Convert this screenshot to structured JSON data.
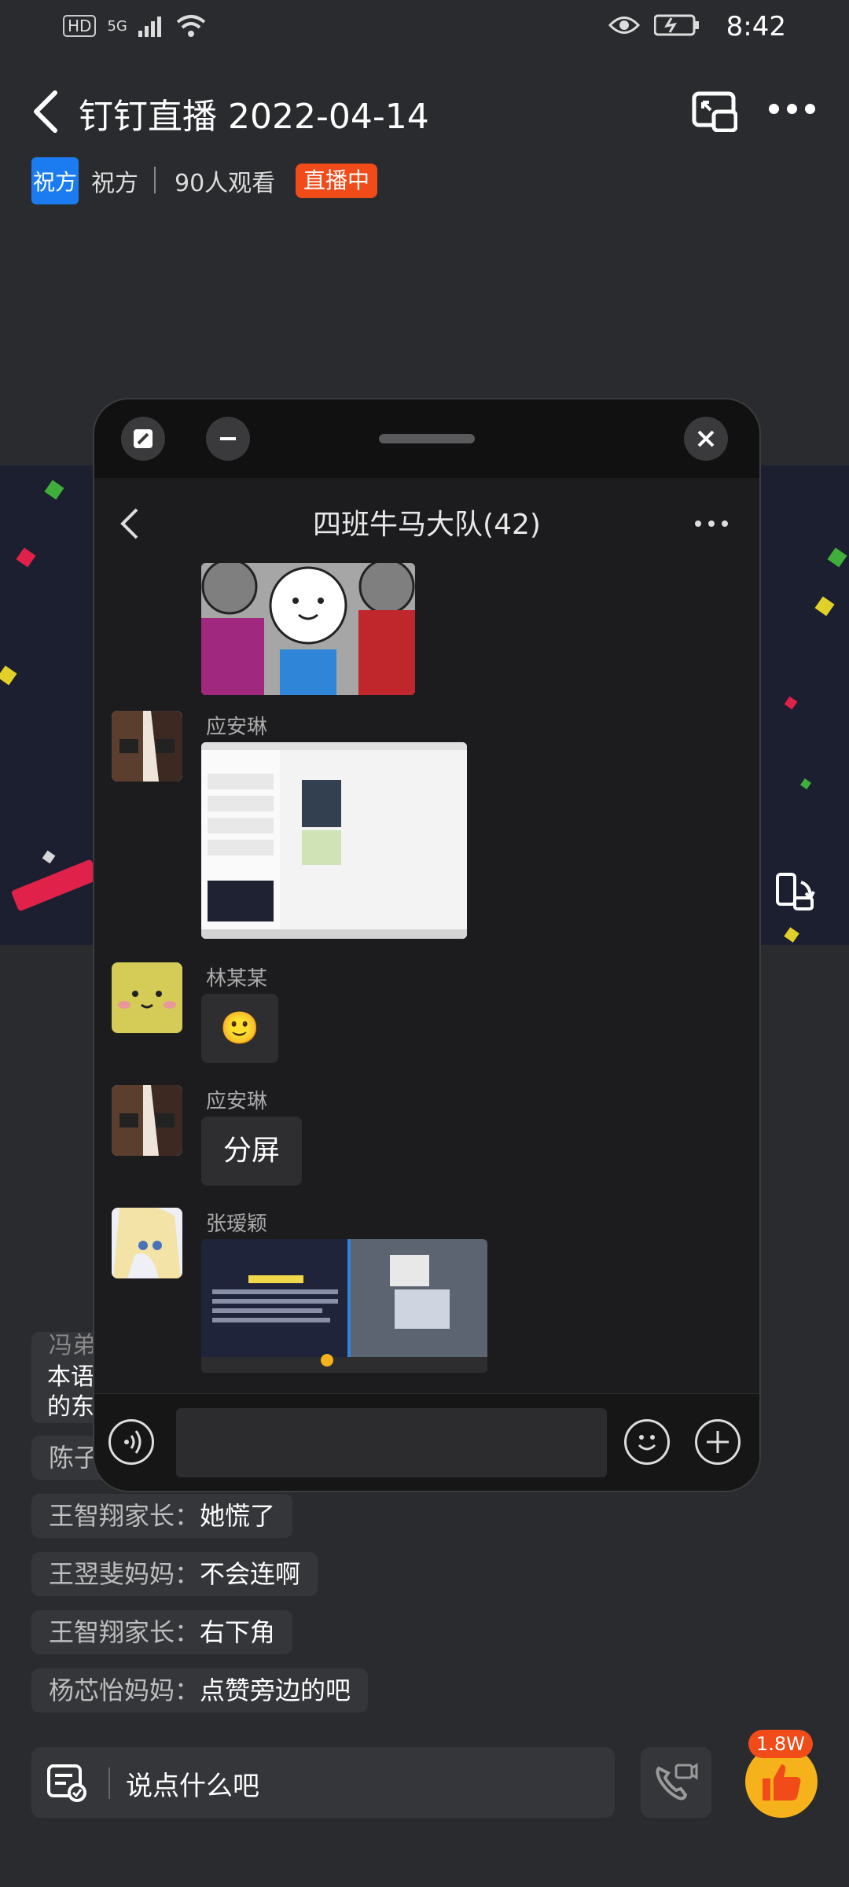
{
  "status_bar": {
    "left_labels": [
      "HD",
      "5G"
    ],
    "time": "8:42"
  },
  "header": {
    "title": "钉钉直播 2022-04-14",
    "host_avatar_text": "祝方",
    "host_name": "祝方",
    "viewers": "90人观看",
    "live_badge": "直播中"
  },
  "floating_window": {
    "title": "四班牛马大队(42)",
    "messages": [
      {
        "sender": "应安琳",
        "type": "image"
      },
      {
        "sender": "林某某",
        "type": "emoji",
        "content": "🙂"
      },
      {
        "sender": "应安琳",
        "type": "text",
        "content": "分屏"
      },
      {
        "sender": "张瑷颖",
        "type": "image"
      }
    ]
  },
  "comments": {
    "partial_1": "冯弟",
    "partial_1_line2": "本语",
    "partial_1_line3": "的东",
    "partial_2": "陈子",
    "items": [
      {
        "who": "王智翔家长：",
        "msg": "她慌了"
      },
      {
        "who": "王翌斐妈妈：",
        "msg": "不会连啊"
      },
      {
        "who": "王智翔家长：",
        "msg": "右下角"
      },
      {
        "who": "杨芯怡妈妈：",
        "msg": "点赞旁边的吧"
      }
    ]
  },
  "input_bar": {
    "placeholder": "说点什么吧"
  },
  "like": {
    "count": "1.8W"
  },
  "colors": {
    "live_badge": "#f04b19",
    "host_avatar": "#1a7cf0",
    "like_button": "#f6b21b"
  }
}
